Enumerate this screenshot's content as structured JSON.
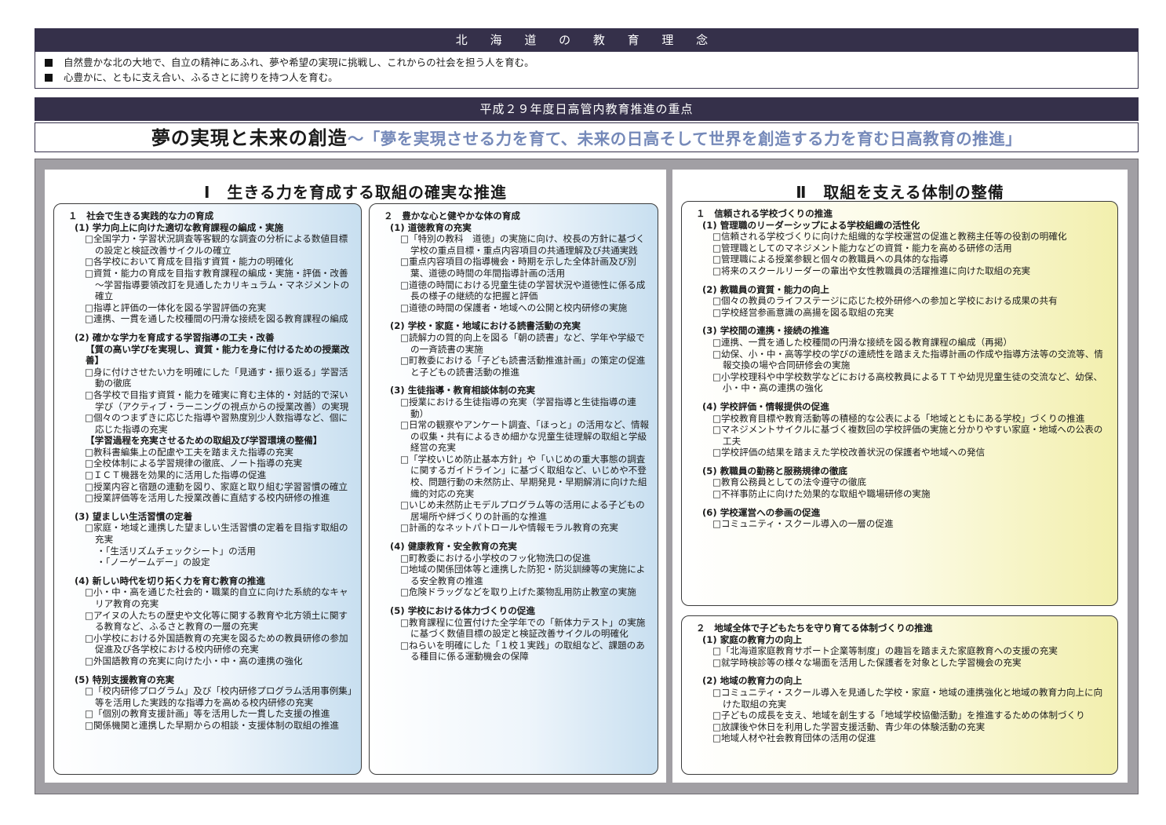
{
  "philosophy": {
    "title": "北 海 道 の 教 育 理 念",
    "lines": [
      "自然豊かな北の大地で、自立の精神にあふれ、夢や希望の実現に挑戦し、これからの社会を担う人を育む。",
      "心豊かに、ともに支え合い、ふるさとに誇りを持つ人を育む。"
    ]
  },
  "priority": {
    "title": "平成２９年度日高管内教育推進の重点",
    "theme_main": "夢の実現と未来の創造",
    "theme_sub": "～「夢を実現させる力を育て、未来の日高そして世界を創造する力を育む日高教育の推進」"
  },
  "pillar1": {
    "heading": "Ⅰ　生きる力を育成する取組の確実な推進",
    "left": {
      "title": "１　社会で生きる実践的な力の育成",
      "subs": [
        {
          "title": "(1) 学力向上に向けた適切な教育課程の編成・実施",
          "items": [
            "□全国学力・学習状況調査等客観的な調査の分析による数値目標の設定と検証改善サイクルの確立",
            "□各学校において育成を目指す資質・能力の明確化",
            "□資質・能力の育成を目指す教育課程の編成・実施・評価・改善～学習指導要領改訂を見通したカリキュラム・マネジメントの確立",
            "□指導と評価の一体化を図る学習評価の充実",
            "□連携、一貫を通した校種間の円滑な接続を図る教育課程の編成"
          ]
        },
        {
          "title": "(2) 確かな学力を育成する学習指導の工夫・改善",
          "note1": "【質の高い学びを実現し、資質・能力を身に付けるための授業改善】",
          "items1": [
            "□身に付けさせたい力を明確にした「見通す・振り返る」学習活動の徹底",
            "□各学校で目指す資質・能力を確実に育む主体的・対話的で深い学び（アクティブ・ラーニングの視点からの授業改善）の実現",
            "□個々のつまずきに応じた指導や習熟度別少人数指導など、個に応じた指導の充実"
          ],
          "note2": "【学習過程を充実させるための取組及び学習環境の整備】",
          "items2": [
            "□教科書編集上の配慮や工夫を踏まえた指導の充実",
            "□全校体制による学習規律の徹底、ノート指導の充実",
            "□ＩＣＴ機器を効果的に活用した指導の促進",
            "□授業内容と宿題の連動を図り、家庭と取り組む学習習慣の確立",
            "□授業評価等を活用した授業改善に直結する校内研修の推進"
          ]
        },
        {
          "title": "(3) 望ましい生活習慣の定着",
          "items": [
            "□家庭・地域と連携した望ましい生活習慣の定着を目指す取組の充実"
          ],
          "dots": [
            "・「生活リズムチェックシート」の活用",
            "・「ノーゲームデー」の設定"
          ]
        },
        {
          "title": "(4) 新しい時代を切り拓く力を育む教育の推進",
          "items": [
            "□小・中・高を通じた社会的・職業的自立に向けた系統的なキャリア教育の充実",
            "□アイヌの人たちの歴史や文化等に関する教育や北方領土に関する教育など、ふるさと教育の一層の充実",
            "□小学校における外国語教育の充実を図るための教員研修の参加促進及び各学校における校内研修の充実",
            "□外国語教育の充実に向けた小・中・高の連携の強化"
          ]
        },
        {
          "title": "(5) 特別支援教育の充実",
          "items": [
            "□「校内研修プログラム」及び「校内研修プログラム活用事例集」等を活用した実践的な指導力を高める校内研修の充実",
            "□「個別の教育支援計画」等を活用した一貫した支援の推進",
            "□関係機関と連携した早期からの相談・支援体制の取組の推進"
          ]
        }
      ]
    },
    "right": {
      "title": "２　豊かな心と健やかな体の育成",
      "subs": [
        {
          "title": "(1) 道徳教育の充実",
          "items": [
            "□「特別の教科　道徳」の実施に向け、校長の方針に基づく学校の重点目標・重点内容項目の共通理解及び共通実践",
            "□重点内容項目の指導機会・時期を示した全体計画及び別葉、道徳の時間の年間指導計画の活用",
            "□道徳の時間における児童生徒の学習状況や道徳性に係る成長の様子の継続的な把握と評価",
            "□道徳の時間の保護者・地域への公開と校内研修の実施"
          ]
        },
        {
          "title": "(2) 学校・家庭・地域における読書活動の充実",
          "items": [
            "□読解力の質的向上を図る「朝の読書」など、学年や学級での一斉読書の実施",
            "□町教委における「子ども読書活動推進計画」の策定の促進と子どもの読書活動の推進"
          ]
        },
        {
          "title": "(3) 生徒指導・教育相談体制の充実",
          "items": [
            "□授業における生徒指導の充実（学習指導と生徒指導の連動）",
            "□日常の観察やアンケート調査、「ほっと」の活用など、情報の収集・共有によるきめ細かな児童生徒理解の取組と学級経営の充実",
            "□「学校いじめ防止基本方針」や「いじめの重大事態の調査に関するガイドライン」に基づく取組など、いじめや不登校、問題行動の未然防止、早期発見・早期解消に向けた組織的対応の充実",
            "□いじめ未然防止モデルプログラム等の活用による子どもの居場所や絆づくりの計画的な推進",
            "□計画的なネットパトロールや情報モラル教育の充実"
          ]
        },
        {
          "title": "(4) 健康教育・安全教育の充実",
          "items": [
            "□町教委における小学校のフッ化物洗口の促進",
            "□地域の関係団体等と連携した防犯・防災訓練等の実施による安全教育の推進",
            "□危険ドラッグなどを取り上げた薬物乱用防止教室の実施"
          ]
        },
        {
          "title": "(5) 学校における体力づくりの促進",
          "items": [
            "□教育課程に位置付けた全学年での「新体力テスト」の実施に基づく数値目標の設定と検証改善サイクルの明確化",
            "□ねらいを明確にした「１校１実践」の取組など、課題のある種目に係る運動機会の保障"
          ]
        }
      ]
    }
  },
  "pillar2": {
    "heading": "Ⅱ　取組を支える体制の整備",
    "top": {
      "title": "１　信頼される学校づくりの推進",
      "subs": [
        {
          "title": "(1) 管理職のリーダーシップによる学校組織の活性化",
          "items": [
            "□信頼される学校づくりに向けた組織的な学校運営の促進と教務主任等の役割の明確化",
            "□管理職としてのマネジメント能力などの資質・能力を高める研修の活用",
            "□管理職による授業参観と個々の教職員への具体的な指導",
            "□将来のスクールリーダーの輩出や女性教職員の活躍推進に向けた取組の充実"
          ]
        },
        {
          "title": "(2) 教職員の資質・能力の向上",
          "items": [
            "□個々の教員のライフステージに応じた校外研修への参加と学校における成果の共有",
            "□学校経営参画意識の高揚を図る取組の充実"
          ]
        },
        {
          "title": "(3) 学校間の連携・接続の推進",
          "items": [
            "□連携、一貫を通した校種間の円滑な接続を図る教育課程の編成（再掲）",
            "□幼保、小・中・高等学校の学びの連続性を踏まえた指導計画の作成や指導方法等の交流等、情報交換の場や合同研修会の実施",
            "□小学校理科や中学校数学などにおける高校教員によるＴＴや幼児児童生徒の交流など、幼保、小・中・高の連携の強化"
          ]
        },
        {
          "title": "(4) 学校評価・情報提供の促進",
          "items": [
            "□学校教育目標や教育活動等の積極的な公表による「地域とともにある学校」づくりの推進",
            "□マネジメントサイクルに基づく複数回の学校評価の実施と分かりやすい家庭・地域への公表の工夫",
            "□学校評価の結果を踏まえた学校改善状況の保護者や地域への発信"
          ]
        },
        {
          "title": "(5) 教職員の勤務と服務規律の徹底",
          "items": [
            "□教育公務員としての法令遵守の徹底",
            "□不祥事防止に向けた効果的な取組や職場研修の実施"
          ]
        },
        {
          "title": "(6) 学校運営への参画の促進",
          "items": [
            "□コミュニティ・スクール導入の一層の促進"
          ]
        }
      ]
    },
    "bottom": {
      "title": "２　地域全体で子どもたちを守り育てる体制づくりの推進",
      "subs": [
        {
          "title": "(1) 家庭の教育力の向上",
          "items": [
            "□「北海道家庭教育サポート企業等制度」の趣旨を踏まえた家庭教育への支援の充実",
            "□就学時検診等の様々な場面を活用した保護者を対象とした学習機会の充実"
          ]
        },
        {
          "title": "(2) 地域の教育力の向上",
          "items": [
            "□コミュニティ・スクール導入を見通した学校・家庭・地域の連携強化と地域の教育力向上に向けた取組の充実",
            "□子どもの成長を支え、地域を創生する「地域学校協働活動」を推進するための体制づくり",
            "□放課後や休日を利用した学習支援活動、青少年の体験活動の充実",
            "□地域人材や社会教育団体の活用の促進"
          ]
        }
      ]
    }
  }
}
